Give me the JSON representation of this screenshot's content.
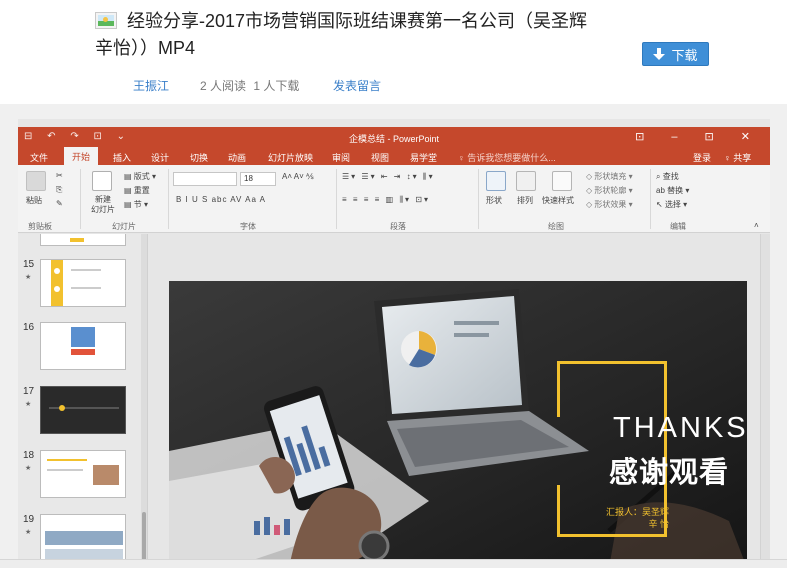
{
  "header": {
    "title_line1": "经验分享-2017市场营销国际班结课赛第一名公司（吴圣辉",
    "title_line2": "辛怡））MP4",
    "download_label": "下载",
    "author": "王振江",
    "reads": "2 人阅读",
    "downloads": "1 人下载",
    "comment_label": "发表留言"
  },
  "ppt": {
    "window_title": "企模总结 - PowerPoint",
    "quick_access": "⊟ ↶ ↷ ⊡ ⌄",
    "window_controls": "⊡ – ⊡ ✕",
    "tabs": [
      "文件",
      "开始",
      "插入",
      "设计",
      "切换",
      "动画",
      "幻灯片放映",
      "审阅",
      "视图",
      "易学堂"
    ],
    "active_tab": "开始",
    "tell_me": "♀ 告诉我您想要做什么...",
    "login": "登录",
    "share": "♀ 共享",
    "ribbon": {
      "paste": "粘贴",
      "clipboard": "剪贴板",
      "new_slide": "新建\n幻灯片",
      "layout": "版式",
      "reset": "重置",
      "section": "节",
      "slides_group": "幻灯片",
      "font_group": "字体",
      "font_size": "18",
      "font_styles": "B  I  U  S  abc  AV  Aa  A",
      "paragraph_group": "段落",
      "shapes": "形状",
      "arrange": "排列",
      "quick_styles": "快速样式",
      "shape_fill": "形状填充",
      "shape_outline": "形状轮廓",
      "shape_effects": "形状效果",
      "drawing_group": "绘图",
      "find": "查找",
      "replace": "替换",
      "select": "选择",
      "editing_group": "编辑"
    },
    "slides": [
      {
        "num": "15",
        "star": "★"
      },
      {
        "num": "16",
        "star": ""
      },
      {
        "num": "17",
        "star": "★"
      },
      {
        "num": "18",
        "star": "★"
      },
      {
        "num": "19",
        "star": "★"
      }
    ],
    "slide": {
      "thanks": "THANKS",
      "chinese": "感谢观看",
      "reporter_line1": "汇报人：吴圣辉",
      "reporter_line2": "辛  怡"
    }
  },
  "colors": {
    "accent_red": "#c5482c",
    "button_blue": "#3f8fd7",
    "link_blue": "#3a7fc9",
    "slide_yellow": "#f2c12e"
  }
}
